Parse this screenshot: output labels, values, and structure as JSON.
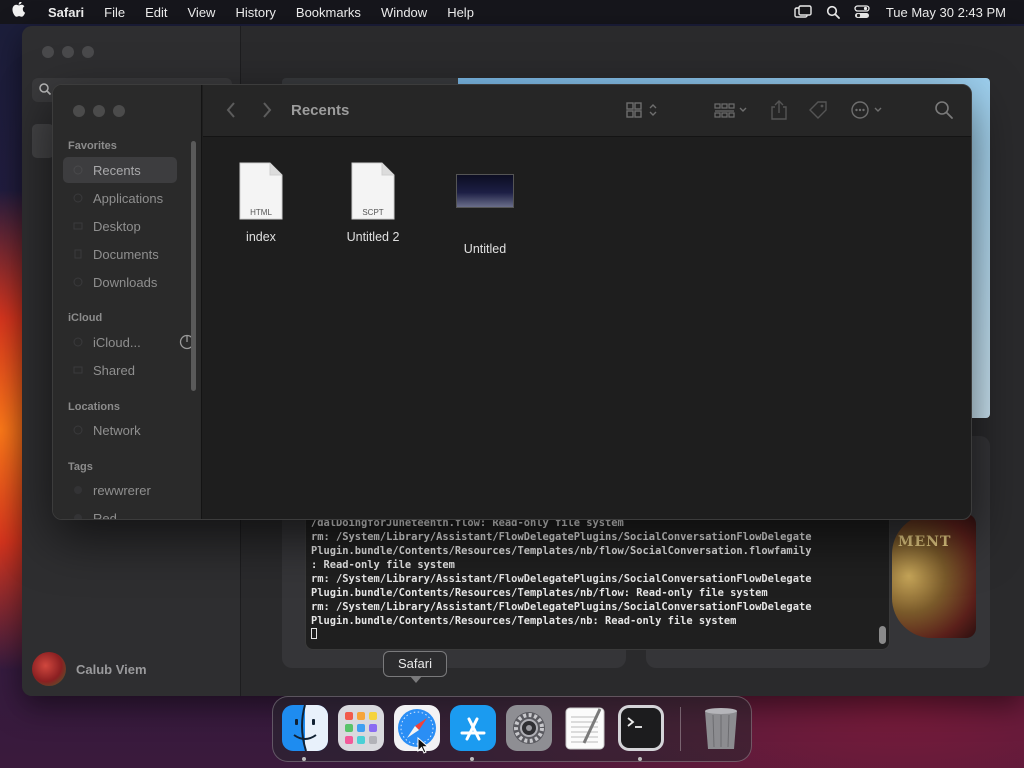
{
  "menubar": {
    "app_name": "Safari",
    "menus": [
      "File",
      "Edit",
      "View",
      "History",
      "Bookmarks",
      "Window",
      "Help"
    ],
    "clock": "Tue May 30  2:43 PM",
    "status_icons": [
      "screen-mirroring-icon",
      "spotlight-search-icon",
      "control-center-icon"
    ]
  },
  "safari": {
    "profile_name": "Calub Viem"
  },
  "terminal": {
    "lines": [
      "/dalDoingforJuneteenth.flow: Read-only file system",
      "rm: /System/Library/Assistant/FlowDelegatePlugins/SocialConversationFlowDelegate",
      "Plugin.bundle/Contents/Resources/Templates/nb/flow/SocialConversation.flowfamily",
      ": Read-only file system",
      "rm: /System/Library/Assistant/FlowDelegatePlugins/SocialConversationFlowDelegate",
      "Plugin.bundle/Contents/Resources/Templates/nb/flow: Read-only file system",
      "rm: /System/Library/Assistant/FlowDelegatePlugins/SocialConversationFlowDelegate",
      "Plugin.bundle/Contents/Resources/Templates/nb: Read-only file system"
    ]
  },
  "game_art_text": "MENT",
  "finder": {
    "title": "Recents",
    "sidebar": {
      "favorites_header": "Favorites",
      "favorites": [
        "Recents",
        "Applications",
        "Desktop",
        "Documents",
        "Downloads"
      ],
      "icloud_header": "iCloud",
      "icloud": [
        "iCloud...",
        "Shared"
      ],
      "locations_header": "Locations",
      "locations": [
        "Network"
      ],
      "tags_header": "Tags",
      "tags": [
        "rewwrerer",
        "Red"
      ]
    },
    "files": [
      {
        "name": "index",
        "kind": "HTML"
      },
      {
        "name": "Untitled 2",
        "kind": "SCPT"
      },
      {
        "name": "Untitled",
        "kind": "image"
      }
    ]
  },
  "dock": {
    "tooltip": "Safari",
    "apps": [
      "Finder",
      "Launchpad",
      "Safari",
      "App Store",
      "System Settings",
      "TextEdit",
      "Terminal",
      "Trash"
    ]
  }
}
